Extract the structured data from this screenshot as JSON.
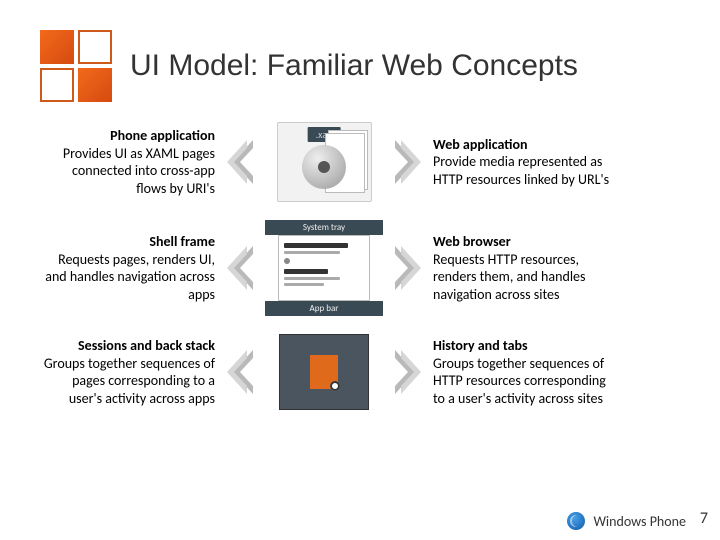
{
  "title": "UI Model: Familiar Web Concepts",
  "rows": [
    {
      "left_head": "Phone application",
      "left_body": "Provides UI as XAML pages connected into cross-app flows by URI's",
      "right_head": "Web application",
      "right_body": "Provide media represented as HTTP resources linked by URL's"
    },
    {
      "left_head": "Shell frame",
      "left_body": "Requests pages, renders UI, and handles navigation across apps",
      "right_head": "Web browser",
      "right_body": "Requests HTTP resources, renders them, and handles navigation across sites"
    },
    {
      "left_head": "Sessions and back stack",
      "left_body": "Groups together sequences of pages corresponding to a user's activity across apps",
      "right_head": "History and tabs",
      "right_body": "Groups together sequences of HTTP resources corresponding to a user's activity across sites"
    }
  ],
  "center": {
    "xap_label": ".xap",
    "system_tray": "System tray",
    "app_bar": "App bar"
  },
  "footer": {
    "brand": "Windows Phone",
    "page_number": "7"
  }
}
